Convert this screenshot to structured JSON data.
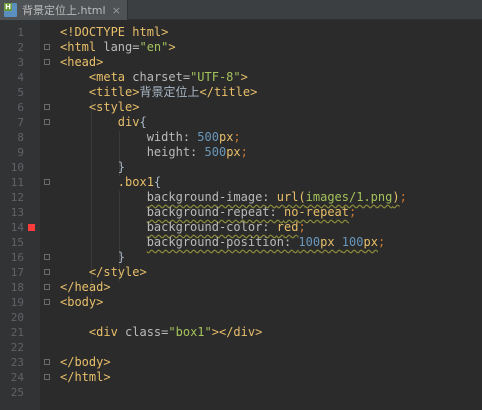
{
  "tab": {
    "filename": "背景定位上.html",
    "icon_letter": "H",
    "close_glyph": "×"
  },
  "lines": [
    {
      "n": "1",
      "parts": [
        {
          "t": "<!DOCTYPE html>",
          "c": "tag"
        }
      ]
    },
    {
      "n": "2",
      "parts": [
        {
          "t": "<html ",
          "c": "tag"
        },
        {
          "t": "lang=",
          "c": "attr"
        },
        {
          "t": "\"en\"",
          "c": "str"
        },
        {
          "t": ">",
          "c": "tag"
        }
      ]
    },
    {
      "n": "3",
      "parts": [
        {
          "t": "<head>",
          "c": "tag"
        }
      ]
    },
    {
      "n": "4",
      "parts": [
        {
          "t": "    "
        },
        {
          "t": "<meta ",
          "c": "tag"
        },
        {
          "t": "charset=",
          "c": "attr"
        },
        {
          "t": "\"UTF-8\"",
          "c": "str"
        },
        {
          "t": ">",
          "c": "tag"
        }
      ]
    },
    {
      "n": "5",
      "parts": [
        {
          "t": "    "
        },
        {
          "t": "<title>",
          "c": "tag"
        },
        {
          "t": "背景定位上",
          "c": "plain"
        },
        {
          "t": "</title>",
          "c": "tag"
        }
      ]
    },
    {
      "n": "6",
      "parts": [
        {
          "t": "    "
        },
        {
          "t": "<style>",
          "c": "tag"
        }
      ]
    },
    {
      "n": "7",
      "parts": [
        {
          "t": "        "
        },
        {
          "t": "div",
          "c": "sel"
        },
        {
          "t": "{",
          "c": "plain"
        }
      ]
    },
    {
      "n": "8",
      "parts": [
        {
          "t": "            "
        },
        {
          "t": "width: ",
          "c": "prop"
        },
        {
          "t": "500",
          "c": "num"
        },
        {
          "t": "px",
          "c": "css"
        },
        {
          "t": ";",
          "c": "punct"
        }
      ]
    },
    {
      "n": "9",
      "parts": [
        {
          "t": "            "
        },
        {
          "t": "height: ",
          "c": "prop"
        },
        {
          "t": "500",
          "c": "num"
        },
        {
          "t": "px",
          "c": "css"
        },
        {
          "t": ";",
          "c": "punct"
        }
      ]
    },
    {
      "n": "10",
      "parts": [
        {
          "t": "        "
        },
        {
          "t": "}",
          "c": "plain"
        }
      ]
    },
    {
      "n": "11",
      "parts": [
        {
          "t": "        "
        },
        {
          "t": ".box1",
          "c": "sel"
        },
        {
          "t": "{",
          "c": "plain"
        }
      ]
    },
    {
      "n": "12",
      "parts": [
        {
          "t": "            "
        },
        {
          "t": "background-image: ",
          "c": "prop",
          "w": 1
        },
        {
          "t": "url(",
          "c": "css",
          "w": 1
        },
        {
          "t": "images/1.png",
          "c": "val",
          "w": 1
        },
        {
          "t": ")",
          "c": "css",
          "w": 1
        },
        {
          "t": ";",
          "c": "punct"
        }
      ]
    },
    {
      "n": "13",
      "parts": [
        {
          "t": "            "
        },
        {
          "t": "background-repeat: ",
          "c": "prop",
          "w": 1
        },
        {
          "t": "no-repeat",
          "c": "css",
          "w": 1
        },
        {
          "t": ";",
          "c": "punct"
        }
      ]
    },
    {
      "n": "14",
      "bp": true,
      "parts": [
        {
          "t": "            "
        },
        {
          "t": "background-color: ",
          "c": "prop",
          "w": 1
        },
        {
          "t": "red",
          "c": "css",
          "w": 1
        },
        {
          "t": ";",
          "c": "punct"
        }
      ]
    },
    {
      "n": "15",
      "parts": [
        {
          "t": "            "
        },
        {
          "t": "background-position: ",
          "c": "prop",
          "w": 1
        },
        {
          "t": "100",
          "c": "num",
          "w": 1
        },
        {
          "t": "px ",
          "c": "css",
          "w": 1
        },
        {
          "t": "100",
          "c": "num",
          "w": 1
        },
        {
          "t": "px",
          "c": "css",
          "w": 1
        },
        {
          "t": ";",
          "c": "punct"
        }
      ]
    },
    {
      "n": "16",
      "parts": [
        {
          "t": "        "
        },
        {
          "t": "}",
          "c": "plain"
        }
      ]
    },
    {
      "n": "17",
      "parts": [
        {
          "t": "    "
        },
        {
          "t": "</style>",
          "c": "tag"
        }
      ]
    },
    {
      "n": "18",
      "parts": [
        {
          "t": "</head>",
          "c": "tag"
        }
      ]
    },
    {
      "n": "19",
      "parts": [
        {
          "t": "<body>",
          "c": "tag"
        }
      ]
    },
    {
      "n": "20",
      "parts": []
    },
    {
      "n": "21",
      "parts": [
        {
          "t": "    "
        },
        {
          "t": "<div ",
          "c": "tag"
        },
        {
          "t": "class=",
          "c": "attr"
        },
        {
          "t": "\"box1\"",
          "c": "str"
        },
        {
          "t": "></div>",
          "c": "tag"
        }
      ]
    },
    {
      "n": "22",
      "parts": []
    },
    {
      "n": "23",
      "parts": [
        {
          "t": "</body>",
          "c": "tag"
        }
      ]
    },
    {
      "n": "24",
      "parts": [
        {
          "t": "</html>",
          "c": "tag"
        }
      ]
    },
    {
      "n": "25",
      "parts": []
    }
  ]
}
